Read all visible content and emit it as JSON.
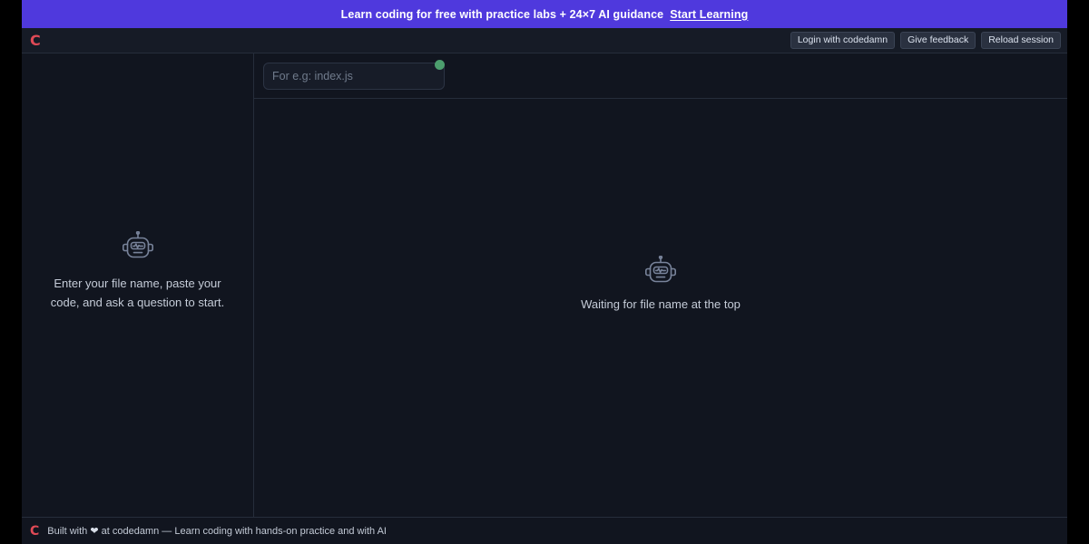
{
  "banner": {
    "text": "Learn coding for free with practice labs + 24×7 AI guidance",
    "link_label": "Start Learning",
    "background_color": "#4f39dd",
    "text_color": "#ffffff"
  },
  "header": {
    "logo_text": "C",
    "logo_color": "#e04a56",
    "buttons": [
      {
        "label": "Login with codedamn",
        "name": "login-button"
      },
      {
        "label": "Give feedback",
        "name": "feedback-button"
      },
      {
        "label": "Reload session",
        "name": "reload-session-button"
      }
    ]
  },
  "chat_panel": {
    "icon": "robot-icon",
    "empty_message": "Enter your file name, paste your code, and ask a question to start."
  },
  "editor_panel": {
    "filename_input": {
      "value": "",
      "placeholder": "For e.g: index.js"
    },
    "status_dot": {
      "name": "connection-status-dot",
      "color": "#4c9e6d"
    },
    "icon": "robot-icon",
    "empty_message": "Waiting for file name at the top"
  },
  "footer": {
    "logo_text": "C",
    "logo_color": "#e04a56",
    "text_before_heart": "Built with",
    "heart": "❤",
    "text_after_heart": "at codedamn — Learn coding with hands-on practice and with AI"
  }
}
